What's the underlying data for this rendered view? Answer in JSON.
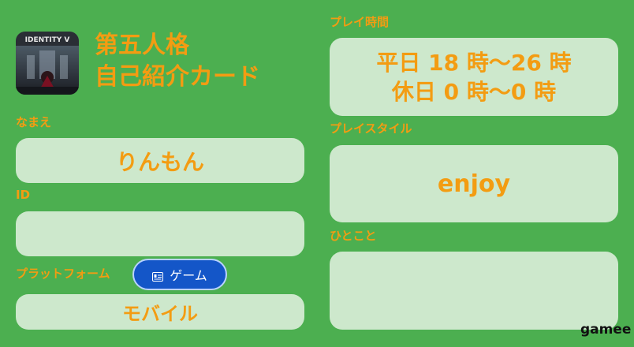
{
  "header": {
    "app_icon": "identity-v-app-icon",
    "title_line1": "第五人格",
    "title_line2": "自己紹介カード"
  },
  "fields": {
    "name_label": "なまえ",
    "name_value": "りんもん",
    "id_label": "ID",
    "id_value": "",
    "platform_label": "プラットフォーム",
    "platform_value": "モバイル",
    "playtime_label": "プレイ時間",
    "playtime_weekday": "平日 18 時〜26 時",
    "playtime_holiday": "休日 0 時〜0 時",
    "playstyle_label": "プレイスタイル",
    "playstyle_value": "enjoy",
    "comment_label": "ひとこと",
    "comment_value": ""
  },
  "game_button": {
    "label": "ゲーム",
    "icon": "id-card-icon"
  },
  "brand": "gamee",
  "colors": {
    "background": "#4caf50",
    "accent": "#f39c12",
    "box": "#cde8cc",
    "button": "#1456c8"
  }
}
